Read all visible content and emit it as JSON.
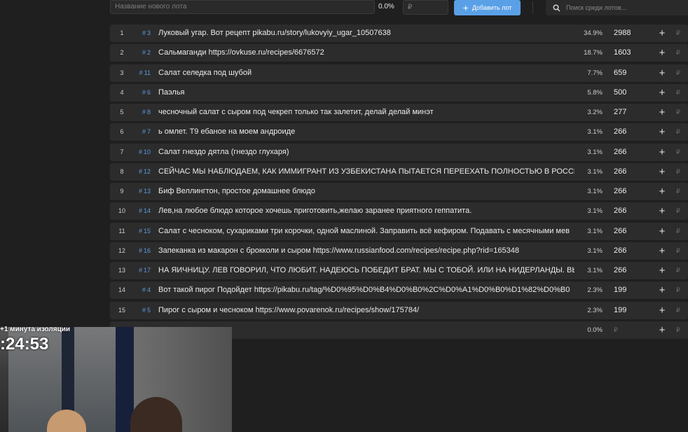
{
  "topbar": {
    "lot_name_placeholder": "Название нового лота",
    "percent": "0.0%",
    "price_placeholder": "₽",
    "add_button": "Добавить лот",
    "search_placeholder": "Поиск среди лотов..."
  },
  "rows": [
    {
      "num": "1",
      "id": "3",
      "title": "Луковый угар. Вот рецепт pikabu.ru/story/lukovyiy_ugar_10507638",
      "pct": "34.9%",
      "sum": "2988"
    },
    {
      "num": "2",
      "id": "2",
      "title": "Сальмаганди https://ovkuse.ru/recipes/6676572",
      "pct": "18.7%",
      "sum": "1603"
    },
    {
      "num": "3",
      "id": "11",
      "title": "Салат селедка под шубой",
      "pct": "7.7%",
      "sum": "659"
    },
    {
      "num": "4",
      "id": "6",
      "title": "Паэлья",
      "pct": "5.8%",
      "sum": "500"
    },
    {
      "num": "5",
      "id": "8",
      "title": "чесночный салат с сыром под чекреп только так залетит, делай делай минэт",
      "pct": "3.2%",
      "sum": "277"
    },
    {
      "num": "6",
      "id": "7",
      "title": "ь омлет. Т9 ебаное на моем андроиде",
      "pct": "3.1%",
      "sum": "266"
    },
    {
      "num": "7",
      "id": "10",
      "title": "Салат гнездо дятла (гнездо глухаря)",
      "pct": "3.1%",
      "sum": "266"
    },
    {
      "num": "8",
      "id": "12",
      "title": "СЕЙЧАС МЫ НАБЛЮДАЕМ, КАК ИММИГРАНТ ИЗ УЗБЕКИСТАНА ПЫТАЕТСЯ ПЕРЕЕХАТЬ ПОЛНОСТЬЮ В РОССИЮ",
      "pct": "3.1%",
      "sum": "266"
    },
    {
      "num": "9",
      "id": "13",
      "title": "Биф Веллингтон, простое домашнее блюдо",
      "pct": "3.1%",
      "sum": "266"
    },
    {
      "num": "10",
      "id": "14",
      "title": "Лев,на любое блюдо которое хочешь приготовить,желаю заранее приятного геппатита.",
      "pct": "3.1%",
      "sum": "266"
    },
    {
      "num": "11",
      "id": "15",
      "title": "Салат с чесноком, сухариками три корочки, одной маслиной. Заправить всё кефиром. Подавать с месячными мев",
      "pct": "3.1%",
      "sum": "266"
    },
    {
      "num": "12",
      "id": "16",
      "title": "Запеканка из макарон с брокколи и сыром https://www.russianfood.com/recipes/recipe.php?rid=165348",
      "pct": "3.1%",
      "sum": "266"
    },
    {
      "num": "13",
      "id": "17",
      "title": "НА ЯИЧНИЦУ. ЛЕВ ГОВОРИЛ, ЧТО ЛЮБИТ. НАДЕЮСЬ ПОБЕДИТ БРАТ. МЫ С ТОБОЙ. ИЛИ НА НИДЕРЛАНДЫ. ВЫІ",
      "pct": "3.1%",
      "sum": "266"
    },
    {
      "num": "14",
      "id": "4",
      "title": "Вот такой пирог Подойдет https://pikabu.ru/tag/%D0%95%D0%B4%D0%B0%2C%D0%A1%D0%B0%D1%82%D0%B0",
      "pct": "2.3%",
      "sum": "199"
    },
    {
      "num": "15",
      "id": "5",
      "title": "Пирог с сыром и чесноком https://www.povarenok.ru/recipes/show/175784/",
      "pct": "2.3%",
      "sum": "199"
    }
  ],
  "empty_row": {
    "pct": "0.0%",
    "sum": "₽"
  },
  "row_add_symbol": "+",
  "row_currency": "₽",
  "hash_symbol": "#",
  "overlay": {
    "label": "+1 минута изоляции",
    "timer": ":24:53"
  },
  "colors": {
    "accent": "#5aa0e6",
    "row_bg": "#2c2c2c",
    "page_bg": "#1f1f1f",
    "id_color": "#5b9bdc"
  }
}
